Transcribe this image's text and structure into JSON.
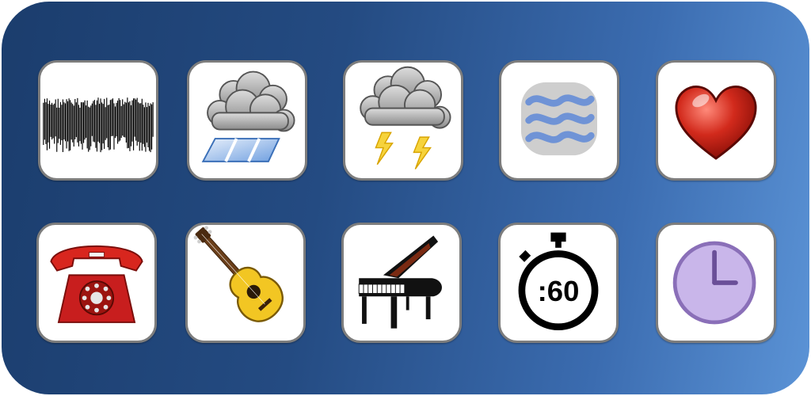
{
  "board": {
    "rows": [
      [
        {
          "icon": "static-noise-icon"
        },
        {
          "icon": "rain-cloud-icon"
        },
        {
          "icon": "thunderstorm-icon"
        },
        {
          "icon": "wind-waves-icon"
        },
        {
          "icon": "heart-icon"
        }
      ],
      [
        {
          "icon": "red-telephone-icon"
        },
        {
          "icon": "acoustic-guitar-icon"
        },
        {
          "icon": "grand-piano-icon"
        },
        {
          "icon": "stopwatch-icon"
        },
        {
          "icon": "clock-icon"
        }
      ]
    ],
    "stopwatch_text": ":60"
  },
  "colors": {
    "panel_gradient_start": "#1b3d6d",
    "panel_gradient_end": "#5b93d6",
    "tile_border": "#7d7d7d",
    "heart": "#d22a1c",
    "telephone": "#c81e1e",
    "guitar_body": "#f2c623",
    "clock_face": "#c9b6ea",
    "clock_rim": "#8a6fb8",
    "waves": "#6f93d6"
  }
}
